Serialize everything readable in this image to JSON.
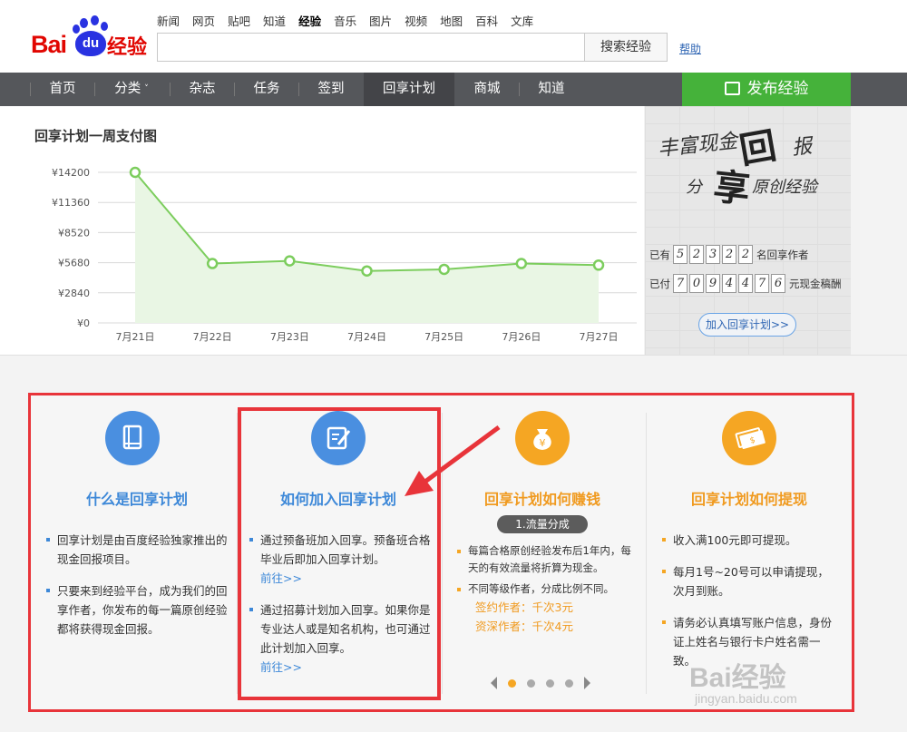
{
  "logo": {
    "bai": "Bai",
    "du": "du",
    "suffix": "经验"
  },
  "topnav": [
    "新闻",
    "网页",
    "贴吧",
    "知道",
    "经验",
    "音乐",
    "图片",
    "视频",
    "地图",
    "百科",
    "文库"
  ],
  "topnav_active": "经验",
  "search": {
    "button": "搜索经验",
    "help": "帮助"
  },
  "mainnav": {
    "items": [
      "首页",
      "分类",
      "杂志",
      "任务",
      "签到",
      "回享计划",
      "商城",
      "知道"
    ],
    "active": "回享计划",
    "publish": "发布经验"
  },
  "chart_data": {
    "type": "area",
    "title": "回享计划一周支付图",
    "categories": [
      "7月21日",
      "7月22日",
      "7月23日",
      "7月24日",
      "7月25日",
      "7月26日",
      "7月27日"
    ],
    "values": [
      14200,
      5600,
      5850,
      4900,
      5050,
      5600,
      5450
    ],
    "yticks": [
      "¥0",
      "¥2840",
      "¥5680",
      "¥8520",
      "¥11360",
      "¥14200"
    ],
    "ylim": [
      0,
      14200
    ],
    "grid": true,
    "color": "#7ccd5d"
  },
  "promo": {
    "line1": "丰富现金",
    "big1": "回",
    "line1b": "报",
    "line2": "分",
    "big2": "享",
    "line2b": "原创经验",
    "authors_pre": "已有",
    "authors_digits": [
      "5",
      "2",
      "3",
      "2",
      "2"
    ],
    "authors_post": "名回享作者",
    "paid_pre": "已付",
    "paid_digits": [
      "7",
      "0",
      "9",
      "4",
      "4",
      "7",
      "6"
    ],
    "paid_post": "元现金稿酬",
    "join": "加入回享计划>>"
  },
  "columns": {
    "what": {
      "title": "什么是回享计划",
      "items": [
        "回享计划是由百度经验独家推出的现金回报项目。",
        "只要来到经验平台，成为我们的回享作者，你发布的每一篇原创经验都将获得现金回报。"
      ]
    },
    "join": {
      "title": "如何加入回享计划",
      "items": [
        "通过预备班加入回享。预备班合格毕业后即加入回享计划。",
        "通过招募计划加入回享。如果你是专业达人或是知名机构，也可通过此计划加入回享。"
      ],
      "goto": "前往>>"
    },
    "earn": {
      "title": "回享计划如何赚钱",
      "badge": "1.流量分成",
      "items": [
        "每篇合格原创经验发布后1年内，每天的有效流量将折算为现金。",
        "不同等级作者，分成比例不同。"
      ],
      "signed": "签约作者：千次3元",
      "senior": "资深作者：千次4元"
    },
    "withdraw": {
      "title": "回享计划如何提现",
      "items": [
        "收入满100元即可提现。",
        "每月1号~20号可以申请提现，次月到账。",
        "请务必认真填写账户信息，身份证上姓名与银行卡户姓名需一致。"
      ]
    }
  },
  "watermark": {
    "brand": "Bai经验",
    "url": "jingyan.baidu.com"
  }
}
